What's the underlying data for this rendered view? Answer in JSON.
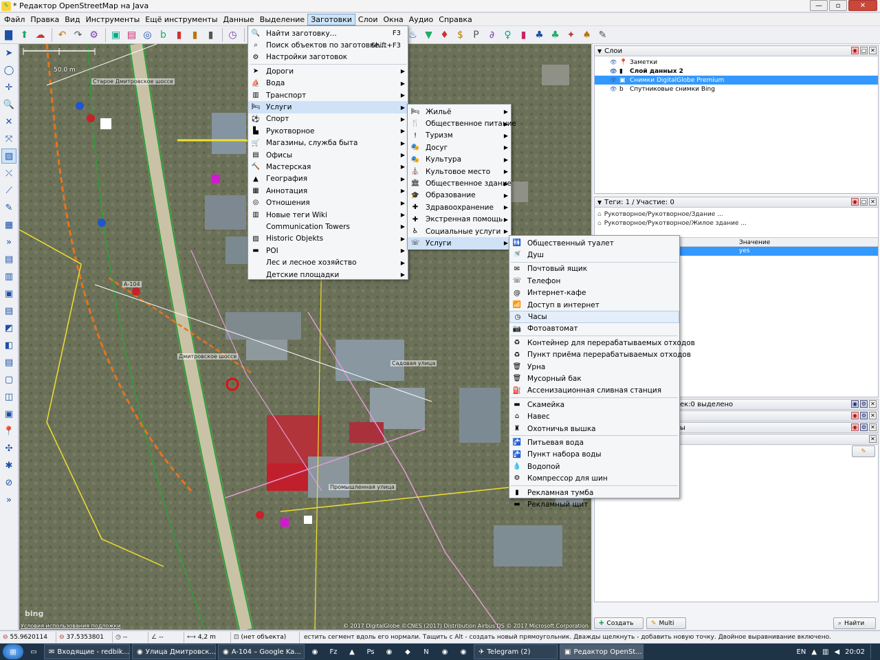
{
  "window": {
    "title": "* Редактор OpenStreetMap на Java",
    "controls": [
      "—",
      "▫",
      "✕"
    ]
  },
  "menubar": [
    {
      "label": "Файл"
    },
    {
      "label": "Правка"
    },
    {
      "label": "Вид"
    },
    {
      "label": "Инструменты"
    },
    {
      "label": "Ещё инструменты"
    },
    {
      "label": "Данные"
    },
    {
      "label": "Выделение"
    },
    {
      "label": "Заготовки",
      "active": true
    },
    {
      "label": "Слои"
    },
    {
      "label": "Окна"
    },
    {
      "label": "Аудио"
    },
    {
      "label": "Справка"
    }
  ],
  "toolbar_icons": [
    "open-file",
    "download",
    "upload",
    "undo",
    "redo",
    "preferences",
    "zoom-out",
    "zoom-in",
    "preset-1",
    "bing",
    "preset-2",
    "preset-3",
    "preset-4",
    "clock",
    "flag-russia",
    "theater",
    "picture",
    "hospital-cross",
    "food",
    "flower",
    "phone",
    "castle",
    "factory",
    "house",
    "restaurant",
    "shop",
    "shirt",
    "dollar",
    "parking",
    "paperclip",
    "person",
    "bag",
    "tree",
    "forest",
    "grass",
    "park",
    "pencil"
  ],
  "toolbar_glyphs": [
    "▇",
    "⬆",
    "☁",
    "↶",
    "↷",
    "⚙",
    "▣",
    "▤",
    "◎",
    "b",
    "▮",
    "▮",
    "▮",
    "◷",
    "▬",
    "☺",
    "▦",
    "✚",
    "☕",
    "✿",
    "☏",
    "♜",
    "▲",
    "⌂",
    "♨",
    "▼",
    "♦",
    "$",
    "P",
    "∂",
    "♀",
    "▮",
    "♣",
    "♣",
    "✦",
    "♠",
    "✎"
  ],
  "left_tools": [
    {
      "name": "select-tool-icon",
      "glyph": "➤",
      "selected": false
    },
    {
      "name": "lasso-tool-icon",
      "glyph": "◯",
      "selected": false
    },
    {
      "name": "draw-tool-icon",
      "glyph": "✛",
      "selected": false
    },
    {
      "name": "zoom-tool-icon",
      "glyph": "🔍",
      "selected": false
    },
    {
      "name": "delete-tool-icon",
      "glyph": "✕",
      "selected": false
    },
    {
      "name": "improve-way-tool-icon",
      "glyph": "⤧",
      "selected": false
    },
    {
      "name": "parallel-tool-icon",
      "glyph": "▨",
      "selected": true
    },
    {
      "name": "split-tool-icon",
      "glyph": "⤬",
      "selected": false
    },
    {
      "name": "measure-tool-icon",
      "glyph": "⟋",
      "selected": false
    },
    {
      "name": "pencil-tool-icon",
      "glyph": "✎",
      "selected": false
    },
    {
      "name": "building-tool-icon",
      "glyph": "▦",
      "selected": false
    },
    {
      "name": "more-tools-icon",
      "glyph": "»",
      "selected": false
    },
    {
      "name": "layer-toggle-1-icon",
      "glyph": "▤",
      "selected": false
    },
    {
      "name": "layer-toggle-2-icon",
      "glyph": "▥",
      "selected": false
    },
    {
      "name": "layer-toggle-3-icon",
      "glyph": "▣",
      "selected": false
    },
    {
      "name": "layer-toggle-4-icon",
      "glyph": "▤",
      "selected": false
    },
    {
      "name": "layer-toggle-5-icon",
      "glyph": "◩",
      "selected": false
    },
    {
      "name": "layer-toggle-6-icon",
      "glyph": "◧",
      "selected": false
    },
    {
      "name": "layer-toggle-7-icon",
      "glyph": "▤",
      "selected": false
    },
    {
      "name": "layer-toggle-8-icon",
      "glyph": "▢",
      "selected": false
    },
    {
      "name": "layer-toggle-9-icon",
      "glyph": "◫",
      "selected": false
    },
    {
      "name": "layer-toggle-10-icon",
      "glyph": "▣",
      "selected": false
    },
    {
      "name": "notes-icon",
      "glyph": "📍",
      "selected": false
    },
    {
      "name": "preset-icon",
      "glyph": "✣",
      "selected": false
    },
    {
      "name": "validator-icon",
      "glyph": "✱",
      "selected": false
    },
    {
      "name": "no-entry-icon",
      "glyph": "⊘",
      "selected": false
    },
    {
      "name": "expand-icon",
      "glyph": "»",
      "selected": false
    }
  ],
  "map": {
    "scale": "50.0 m",
    "bing_logo": "bing",
    "terms": "Условия использования подложки",
    "attribution": "© 2017 DigitalGlobe ©CNES (2017) Distribution Airbus DS © 2017 Microsoft Corporation",
    "street_labels": [
      "Дмитровское шоссе",
      "Старое Дмитровское шоссе",
      "А-104",
      "Промышленная улица",
      "Садовая улица"
    ]
  },
  "presets_menu": {
    "items": [
      {
        "label": "Найти заготовку...",
        "shortcut": "F3",
        "icon": "🔍",
        "submenu": false
      },
      {
        "label": "Поиск объектов по заготовке...",
        "shortcut": "Shift+F3",
        "icon": "⌕",
        "submenu": false
      },
      {
        "label": "Настройки заготовок",
        "shortcut": "",
        "icon": "⚙",
        "submenu": false,
        "sep_after": true
      },
      {
        "label": "Дороги",
        "icon": "➤",
        "submenu": true
      },
      {
        "label": "Вода",
        "icon": "⛵",
        "submenu": true
      },
      {
        "label": "Транспорт",
        "icon": "▥",
        "submenu": true
      },
      {
        "label": "Услуги",
        "icon": "🛏",
        "submenu": true,
        "highlight": true
      },
      {
        "label": "Спорт",
        "icon": "⚽",
        "submenu": true
      },
      {
        "label": "Рукотворное",
        "icon": "▙",
        "submenu": true
      },
      {
        "label": "Магазины, служба быта",
        "icon": "🛒",
        "submenu": true
      },
      {
        "label": "Офисы",
        "icon": "▤",
        "submenu": true
      },
      {
        "label": "Мастерская",
        "icon": "🔨",
        "submenu": true
      },
      {
        "label": "География",
        "icon": "▲",
        "submenu": true
      },
      {
        "label": "Аннотация",
        "icon": "▦",
        "submenu": true
      },
      {
        "label": "Отношения",
        "icon": "◎",
        "submenu": true
      },
      {
        "label": "Новые теги Wiki",
        "icon": "▥",
        "submenu": true
      },
      {
        "label": "Communication Towers",
        "icon": "",
        "submenu": true
      },
      {
        "label": "Historic Objekts",
        "icon": "▨",
        "submenu": true
      },
      {
        "label": "POI",
        "icon": "▬",
        "submenu": true
      },
      {
        "label": "Лес и лесное хозяйство",
        "icon": "",
        "submenu": true
      },
      {
        "label": "Детские площадки",
        "icon": "",
        "submenu": true
      }
    ]
  },
  "services_menu": {
    "items": [
      {
        "label": "Жильё",
        "icon": "🛏"
      },
      {
        "label": "Общественное питание",
        "icon": "🍴"
      },
      {
        "label": "Туризм",
        "icon": "!"
      },
      {
        "label": "Досуг",
        "icon": "🎭"
      },
      {
        "label": "Культура",
        "icon": "🎭"
      },
      {
        "label": "Культовое место",
        "icon": "⛪"
      },
      {
        "label": "Общественное здание",
        "icon": "🏛"
      },
      {
        "label": "Образование",
        "icon": "🎓"
      },
      {
        "label": "Здравоохранение",
        "icon": "✚"
      },
      {
        "label": "Экстренная помощь",
        "icon": "✚"
      },
      {
        "label": "Социальные услуги",
        "icon": "♿"
      },
      {
        "label": "Услуги",
        "icon": "☏",
        "highlight": true
      }
    ]
  },
  "utilities_menu": {
    "items": [
      {
        "label": "Общественный туалет",
        "icon": "🚻"
      },
      {
        "label": "Душ",
        "icon": "🚿",
        "sep_after": true
      },
      {
        "label": "Почтовый ящик",
        "icon": "✉"
      },
      {
        "label": "Телефон",
        "icon": "☏"
      },
      {
        "label": "Интернет-кафе",
        "icon": "@"
      },
      {
        "label": "Доступ в интернет",
        "icon": "📶"
      },
      {
        "label": "Часы",
        "icon": "◷",
        "highlight": true
      },
      {
        "label": "Фотоавтомат",
        "icon": "📷",
        "sep_after": true
      },
      {
        "label": "Контейнер для перерабатываемых отходов",
        "icon": "♻"
      },
      {
        "label": "Пункт приёма перерабатываемых отходов",
        "icon": "♻"
      },
      {
        "label": "Урна",
        "icon": "🗑"
      },
      {
        "label": "Мусорный бак",
        "icon": "🗑"
      },
      {
        "label": "Ассенизационная сливная станция",
        "icon": "⛽",
        "sep_after": true
      },
      {
        "label": "Скамейка",
        "icon": "▬"
      },
      {
        "label": "Навес",
        "icon": "⌂"
      },
      {
        "label": "Охотничья вышка",
        "icon": "♜",
        "sep_after": true
      },
      {
        "label": "Питьевая вода",
        "icon": "🚰"
      },
      {
        "label": "Пункт набора воды",
        "icon": "🚰"
      },
      {
        "label": "Водопой",
        "icon": "💧"
      },
      {
        "label": "Компрессор для шин",
        "icon": "⚙",
        "sep_after": true
      },
      {
        "label": "Рекламная тумба",
        "icon": "▮"
      },
      {
        "label": "Рекламный щит",
        "icon": "▬"
      }
    ]
  },
  "layers_panel": {
    "title": "Слои",
    "rows": [
      {
        "label": "Заметки",
        "icon": "📍",
        "bold": false,
        "selected": false
      },
      {
        "label": "Слой данных 2",
        "icon": "▮",
        "bold": true,
        "selected": false
      },
      {
        "label": "Снимки DigitalGlobe Premium",
        "icon": "▣",
        "bold": false,
        "selected": true
      },
      {
        "label": "Спутниковые снимки Bing",
        "icon": "b",
        "bold": false,
        "selected": false
      }
    ]
  },
  "tags_panel": {
    "title": "Теги: 1 / Участие: 0",
    "rows": [
      "Рукотворное/Рукотворное/Здание ...",
      "Рукотворное/Рукотворное/Жилое здание ..."
    ],
    "value_header": "Значение",
    "selected_value": "yes"
  },
  "selection_panel": {
    "title_fragment": "ек:0 выделено"
  },
  "fragment_panel": {
    "suffix_1": "ы",
    "suffix_2": ")"
  },
  "panel_buttons": {
    "create": "Создать",
    "multi": "Multi",
    "search": "Найти"
  },
  "statusbar": {
    "lat": "55.9620114",
    "lon": "37.5353801",
    "heading": "--",
    "angle": "--",
    "distance": "4,2 m",
    "object": "(нет объекта)",
    "help": "естить сегмент вдоль его нормали. Тащить с Alt - создать новый прямоугольник. Дважды щелкнуть - добавить новую точку. Двойное выравнивание включено."
  },
  "taskbar": {
    "tasks": [
      {
        "label": "Входящие - redbik...",
        "icon": "✉",
        "active": false
      },
      {
        "label": "Улица Дмитровск...",
        "icon": "◉",
        "active": false
      },
      {
        "label": "A-104 – Google Ka...",
        "icon": "◉",
        "active": false
      },
      {
        "label": "Telegram (2)",
        "icon": "✈",
        "active": false
      },
      {
        "label": "Редактор OpenSt...",
        "icon": "▣",
        "active": true
      }
    ],
    "quick": [
      "◉",
      "Fz",
      "▲",
      "Ps",
      "◉",
      "◆",
      "N",
      "◉",
      "◉"
    ],
    "lang": "EN",
    "time": "20:02"
  },
  "colors": {
    "selection": "#3399ff",
    "menu_highlight": "#cfe2f7",
    "road_green": "#2e9e3a",
    "route_orange": "#e8731c",
    "boundary_yellow": "#f0e030",
    "building_pink": "#e39ad8"
  }
}
